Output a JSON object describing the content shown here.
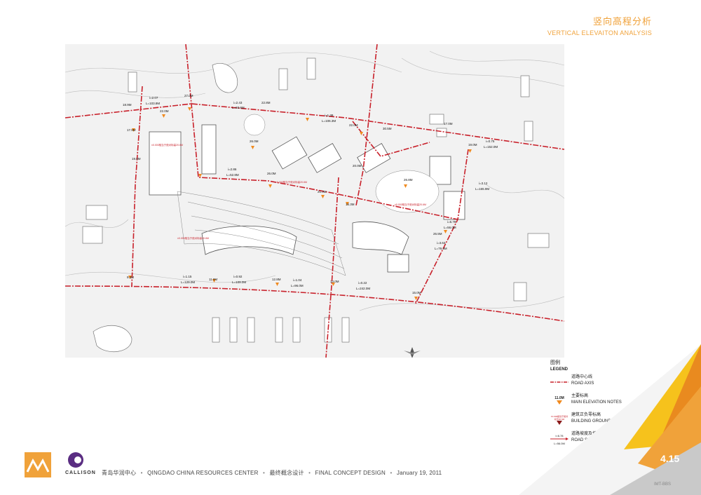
{
  "header": {
    "title_cn": "竖向高程分析",
    "title_en": "VERTICAL ELEVAITON ANALYSIS"
  },
  "plan": {
    "elevations": [
      "27.0M",
      "22.0M",
      "26.0M",
      "22.8M",
      "18.9M",
      "17.9M",
      "19.9M",
      "26.8M",
      "30.5M",
      "22.0M",
      "20.0M",
      "26.0M",
      "21.0M",
      "16.3M",
      "11.0M",
      "12.8M",
      "13.0M",
      "15.0M",
      "9.3M",
      "17.0M",
      "19.0M",
      "26.5M"
    ],
    "slopes": [
      "i=2.07",
      "L=103.8M",
      "i=2.43",
      "L=93.6M",
      "i=1.38",
      "L=106.3M",
      "i=2.86",
      "L=52.8M",
      "i=1.15",
      "L=129.0M",
      "i=0.92",
      "L=109.0M",
      "i=1.04",
      "L=96.0M",
      "i=0.22",
      "L=242.0M",
      "i=3.63",
      "L=79.3M",
      "i=6.78",
      "L=56.0M",
      "i=3.12",
      "L=165.9M",
      "i=0.75",
      "L=152.0M"
    ],
    "building_note": "±0.000相当于绝对标高20.6M"
  },
  "legend": {
    "title_cn": "图例",
    "title_en": "LEGEND",
    "items": [
      {
        "cn": "道路中心线",
        "en": "ROAD AXIS",
        "sym": ""
      },
      {
        "cn": "主要标高",
        "en": "MAIN ELEVATION NOTES",
        "sym": "11.0M"
      },
      {
        "cn": "建筑正负零标高",
        "en": "BUILDING GROUND ELEVATION NOTES",
        "sym": "±0.000相当于绝对标高20.6M"
      },
      {
        "cn": "道路坡度及坡长",
        "en": "ROAD SLOPE & SLOPE LENGTH",
        "sym_top": "i=6.78",
        "sym": "L=56.0M"
      }
    ]
  },
  "footer": {
    "project_cn": "青岛华润中心",
    "project_en": "QINGDAO CHINA RESOURCES CENTER",
    "stage_cn": "最终概念设计",
    "stage_en": "FINAL CONCEPT DESIGN",
    "date": "January 19, 2011",
    "logo_text": "CALLISON"
  },
  "page_number": "4.15",
  "watermark": "IMT-BBS",
  "colors": {
    "accent": "#f0a23a",
    "road_axis": "#c8202a",
    "marker": "#f08a1f",
    "plan_bg": "#f2f2f2"
  }
}
